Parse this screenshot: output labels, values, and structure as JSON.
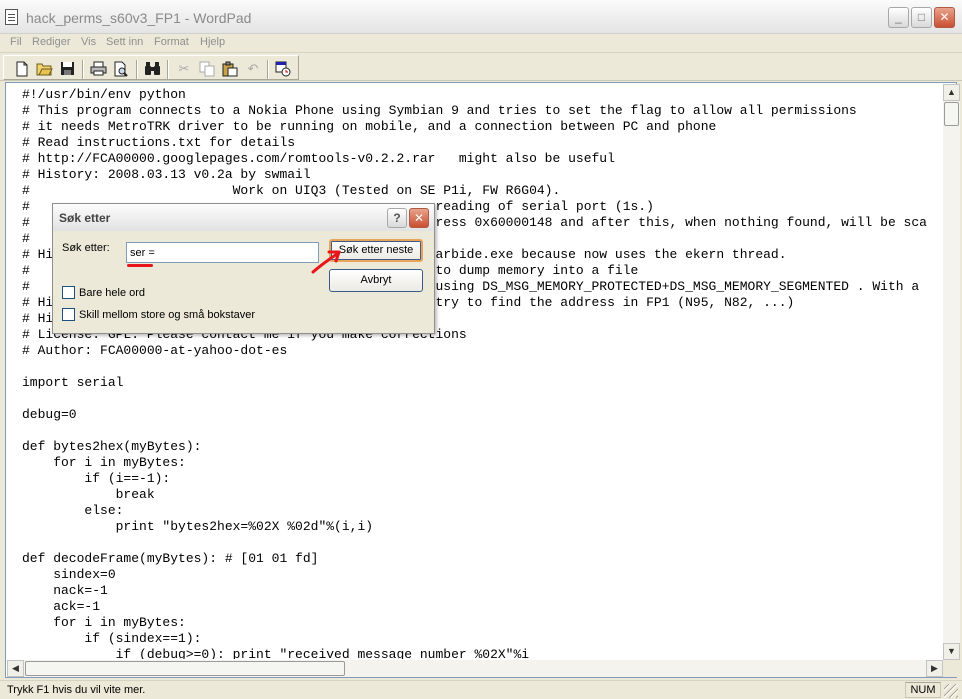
{
  "window": {
    "title": "hack_perms_s60v3_FP1 - WordPad",
    "minimize": "_",
    "maximize": "□",
    "close": "✕"
  },
  "menu": [
    "Fil",
    "Rediger",
    "Vis",
    "Sett inn",
    "Format",
    "Hjelp"
  ],
  "toolbar_icons": [
    "new-icon",
    "open-icon",
    "save-icon",
    "print-icon",
    "print-preview-icon",
    "find-icon",
    "cut-icon",
    "copy-icon",
    "paste-icon",
    "undo-icon",
    "date-time-icon"
  ],
  "document": {
    "lines": [
      "#!/usr/bin/env python",
      "# This program connects to a Nokia Phone using Symbian 9 and tries to set the flag to allow all permissions",
      "# it needs MetroTRK driver to be running on mobile, and a connection between PC and phone",
      "# Read instructions.txt for details",
      "# http://FCA00000.googlepages.com/romtools-v0.2.2.rar   might also be useful",
      "# History: 2008.03.13 v0.2a by swmail",
      "#                          Work on UIQ3 (Tested on SE P1i, FW R6G04).",
      "#                                                    reading of serial port (1s.)",
      "#                                                    ress 0x60000148 and after this, when nothing found, will be sca",
      "#",
      "# Hi                                                Carbide.exe because now uses the ekern thread.",
      "#                                                    to dump memory into a file",
      "#                                                    using DS_MSG_MEMORY_PROTECTED+DS_MSG_MEMORY_SEGMENTED . With a",
      "# Hi                                                 try to find the address in FP1 (N95, N82, ...)",
      "# Hi",
      "# License: GPL. Please contact me if you make corrections",
      "# Author: FCA00000-at-yahoo-dot-es",
      "",
      "import serial",
      "",
      "debug=0",
      "",
      "def bytes2hex(myBytes):",
      "    for i in myBytes:",
      "        if (i==-1):",
      "            break",
      "        else:",
      "            print \"bytes2hex=%02X %02d\"%(i,i)",
      "",
      "def decodeFrame(myBytes): # [01 01 fd]",
      "    sindex=0",
      "    nack=-1",
      "    ack=-1",
      "    for i in myBytes:",
      "        if (sindex==1):",
      "            if (debug>=0): print \"received message number %02X\"%i"
    ]
  },
  "dialog": {
    "title": "Søk etter",
    "help": "?",
    "close": "✕",
    "find_label": "Søk etter:",
    "find_value": "ser =",
    "find_next_button": "Søk etter neste",
    "cancel_button": "Avbryt",
    "whole_word_label": "Bare hele ord",
    "match_case_label": "Skill mellom store og små bokstaver",
    "whole_word_checked": false,
    "match_case_checked": false
  },
  "annotation_colors": {
    "highlight": "#e8151b"
  },
  "statusbar": {
    "text": "Trykk F1 hvis du vil vite mer.",
    "num": "NUM"
  }
}
